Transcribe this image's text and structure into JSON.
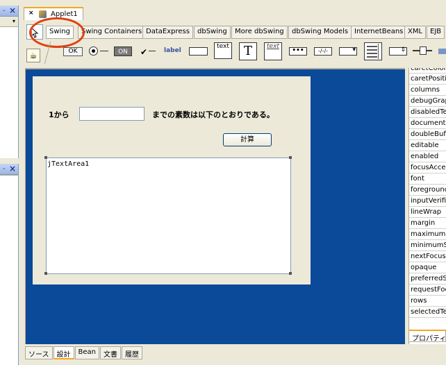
{
  "left_panel": {
    "top_collapse": "-",
    "bottom_collapse": "-",
    "close_glyph": "×",
    "dropdown_glyph": "▾"
  },
  "editor_tab": {
    "close_glyph": "×",
    "label": "Applet1"
  },
  "palette": {
    "tabs": [
      "Swing",
      "Swing Containers",
      "DataExpress",
      "dbSwing",
      "More dbSwing",
      "dbSwing Models",
      "InternetBeans",
      "XML",
      "EJB"
    ],
    "active_tab": "Swing",
    "components": {
      "button_label": "OK",
      "toggle_label": "ON",
      "check_glyph": "✔",
      "label_text": "label",
      "textarea_text": "text",
      "textpane_text": "T",
      "editorpane_text": "text",
      "password_text": "•••",
      "formatted_text": "-/-/-"
    }
  },
  "form": {
    "from_label": "1から",
    "number_input_value": "",
    "result_label": "までの素数は以下のとおりである。",
    "calc_button": "計算",
    "textarea_text": "jTextArea1"
  },
  "properties": {
    "rows": [
      "caretColor",
      "caretPosition",
      "columns",
      "debugGraphicsOptions",
      "disabledTextColor",
      "document",
      "doubleBuffered",
      "editable",
      "enabled",
      "focusAccelerator",
      "font",
      "foreground",
      "inputVerifier",
      "lineWrap",
      "margin",
      "maximumSize",
      "minimumSize",
      "nextFocusableComponent",
      "opaque",
      "preferredSize",
      "requestFocusEnabled",
      "rows",
      "selectedTextColor"
    ],
    "tab_label": "プロパティ"
  },
  "bottom_tabs": [
    "ソース",
    "設計",
    "Bean",
    "文書",
    "履歴"
  ],
  "active_bottom_tab": "設計",
  "colors": {
    "designer_bg": "#0a4a98",
    "highlight_circle": "#e04010"
  }
}
